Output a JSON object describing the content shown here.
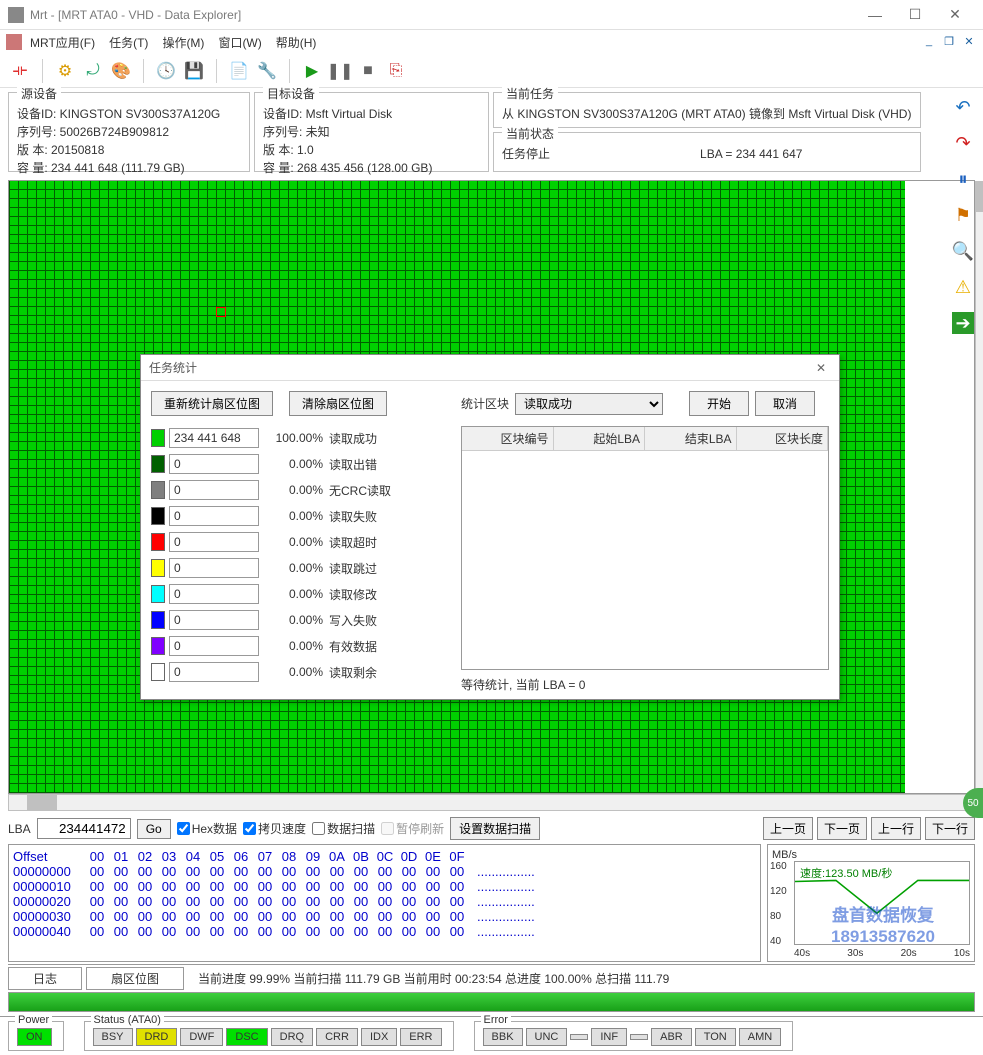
{
  "window": {
    "title": "Mrt - [MRT ATA0 - VHD - Data Explorer]",
    "min": "—",
    "max": "☐",
    "close": "✕",
    "mdi_min": "_",
    "mdi_max": "❐",
    "mdi_close": "✕"
  },
  "menu": {
    "app": "MRT应用(F)",
    "task": "任务(T)",
    "op": "操作(M)",
    "win": "窗口(W)",
    "help": "帮助(H)"
  },
  "panels": {
    "src_title": "源设备",
    "src_l1": "设备ID: KINGSTON SV300S37A120G",
    "src_l2": "序列号: 50026B724B909812",
    "src_l3": "版   本: 20150818",
    "src_l4": "容   量: 234 441 648 (111.79 GB)",
    "dst_title": "目标设备",
    "dst_l1": "设备ID: Msft Virtual Disk",
    "dst_l2": "序列号: 未知",
    "dst_l3": "版   本: 1.0",
    "dst_l4": "容   量: 268 435 456 (128.00 GB)",
    "task_title": "当前任务",
    "task_l1": "从 KINGSTON SV300S37A120G (MRT ATA0) 镜像到 Msft Virtual Disk (VHD)",
    "state_title": "当前状态",
    "state_l1": "任务停止",
    "state_l2": "LBA = 234 441 647"
  },
  "dialog": {
    "title": "任务统计",
    "btn_recalc": "重新统计扇区位图",
    "btn_clear": "清除扇区位图",
    "lbl_block": "统计区块",
    "sel_block": "读取成功",
    "btn_start": "开始",
    "btn_cancel": "取消",
    "stats": [
      {
        "color": "#00d000",
        "val": "234 441 648",
        "pct": "100.00%",
        "lbl": "读取成功"
      },
      {
        "color": "#006000",
        "val": "0",
        "pct": "0.00%",
        "lbl": "读取出错"
      },
      {
        "color": "#808080",
        "val": "0",
        "pct": "0.00%",
        "lbl": "无CRC读取"
      },
      {
        "color": "#000000",
        "val": "0",
        "pct": "0.00%",
        "lbl": "读取失败"
      },
      {
        "color": "#ff0000",
        "val": "0",
        "pct": "0.00%",
        "lbl": "读取超时"
      },
      {
        "color": "#ffff00",
        "val": "0",
        "pct": "0.00%",
        "lbl": "读取跳过"
      },
      {
        "color": "#00ffff",
        "val": "0",
        "pct": "0.00%",
        "lbl": "读取修改"
      },
      {
        "color": "#0000ff",
        "val": "0",
        "pct": "0.00%",
        "lbl": "写入失败"
      },
      {
        "color": "#8000ff",
        "val": "0",
        "pct": "0.00%",
        "lbl": "有效数据"
      },
      {
        "color": "#ffffff",
        "val": "0",
        "pct": "0.00%",
        "lbl": "读取剩余"
      }
    ],
    "th1": "区块编号",
    "th2": "起始LBA",
    "th3": "结束LBA",
    "th4": "区块长度",
    "wait": "等待统计, 当前 LBA = 0"
  },
  "lba_row": {
    "lbl": "LBA",
    "val": "234441472",
    "go": "Go",
    "cb_hex": "Hex数据",
    "cb_copy": "拷贝速度",
    "cb_scan": "数据扫描",
    "cb_pause": "暂停刷新",
    "btn_set": "设置数据扫描",
    "nav_pp": "上一页",
    "nav_np": "下一页",
    "nav_pr": "上一行",
    "nav_nr": "下一行"
  },
  "hex": {
    "header": "Offset",
    "cols": [
      "00",
      "01",
      "02",
      "03",
      "04",
      "05",
      "06",
      "07",
      "08",
      "09",
      "0A",
      "0B",
      "0C",
      "0D",
      "0E",
      "0F"
    ],
    "rows": [
      {
        "off": "00000000",
        "b": "00 00 00 00 00 00 00 00 00 00 00 00 00 00 00 00",
        "a": "................"
      },
      {
        "off": "00000010",
        "b": "00 00 00 00 00 00 00 00 00 00 00 00 00 00 00 00",
        "a": "................"
      },
      {
        "off": "00000020",
        "b": "00 00 00 00 00 00 00 00 00 00 00 00 00 00 00 00",
        "a": "................"
      },
      {
        "off": "00000030",
        "b": "00 00 00 00 00 00 00 00 00 00 00 00 00 00 00 00",
        "a": "................"
      },
      {
        "off": "00000040",
        "b": "00 00 00 00 00 00 00 00 00 00 00 00 00 00 00 00",
        "a": "................"
      }
    ]
  },
  "speedchart": {
    "unit": "MB/s",
    "y": [
      "160",
      "120",
      "80",
      "40"
    ],
    "x": [
      "40s",
      "30s",
      "20s",
      "10s"
    ],
    "speed": "速度:123.50 MB/秒",
    "wm1": "盘首数据恢复",
    "wm2": "18913587620"
  },
  "chart_data": {
    "type": "line",
    "title": "",
    "xlabel": "",
    "ylabel": "MB/s",
    "ylim": [
      0,
      160
    ],
    "x": [
      "40s",
      "30s",
      "20s",
      "10s"
    ],
    "series": [
      {
        "name": "速度",
        "values": [
          122,
          124,
          60,
          125
        ]
      }
    ]
  },
  "tabs": {
    "log": "日志",
    "map": "扇区位图",
    "progress": "当前进度 99.99% 当前扫描 111.79 GB 当前用时 00:23:54   总进度 100.00% 总扫描 111.79"
  },
  "status": {
    "power": "Power",
    "on": "ON",
    "status": "Status (ATA0)",
    "leds": [
      "BSY",
      "DRD",
      "DWF",
      "DSC",
      "DRQ",
      "CRR",
      "IDX",
      "ERR"
    ],
    "error": "Error",
    "eleds": [
      "BBK",
      "UNC",
      "",
      "INF",
      "",
      "ABR",
      "TON",
      "AMN"
    ]
  },
  "badge": "50"
}
